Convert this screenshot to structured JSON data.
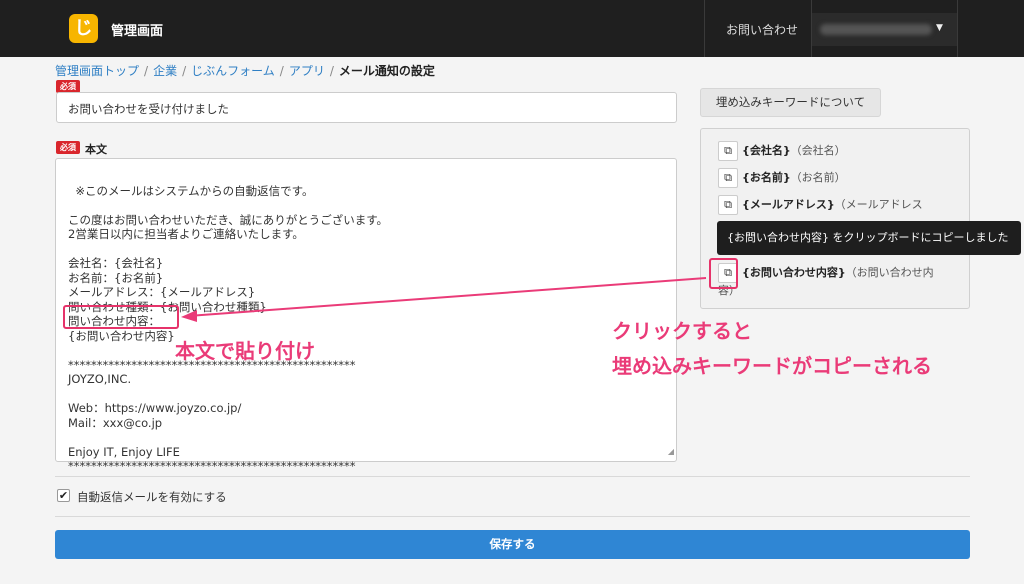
{
  "header": {
    "logo_glyph": "じ",
    "app_title": "管理画面",
    "nav_contact": "お問い合わせ",
    "user_caret": "▼"
  },
  "breadcrumb": {
    "items": [
      "管理画面トップ",
      "企業",
      "じぶんフォーム",
      "アプリ"
    ],
    "separator": "/",
    "current": "メール通知の設定"
  },
  "form": {
    "required_badge": "必須",
    "subject_value": "お問い合わせを受け付けました",
    "body_label": "本文",
    "body_text": "※このメールはシステムからの自動返信です。\n\nこの度はお問い合わせいただき、誠にありがとうございます。\n2営業日以内に担当者よりご連絡いたします。\n\n会社名：{会社名}\nお名前：{お名前}\nメールアドレス：{メールアドレス}\n問い合わせ種類：{お問い合わせ種類}\n問い合わせ内容：\n{お問い合わせ内容}\n\n**************************************************\nJOYZO,INC.\n\nWeb：https://www.joyzo.co.jp/\nMail：xxx@co.jp\n\nEnjoy IT, Enjoy LIFE\n**************************************************",
    "autoreply_label": "自動返信メールを有効にする",
    "autoreply_checked": true,
    "save_label": "保存する"
  },
  "keywords": {
    "button_label": "埋め込みキーワードについて",
    "items": [
      {
        "key": "{会社名}",
        "desc": "（会社名）"
      },
      {
        "key": "{お名前}",
        "desc": "（お名前）"
      },
      {
        "key": "{メールアドレス}",
        "desc": "（メールアドレス"
      },
      {
        "key": "{お問い合わせ内容}",
        "desc": "（お問い合わせ内容）"
      }
    ],
    "tooltip": "{お問い合わせ内容} をクリップボードにコピーしました"
  },
  "annotations": {
    "paste": "本文で貼り付け",
    "copy_line1": "クリックすると",
    "copy_line2": "埋め込みキーワードがコピーされる"
  },
  "colors": {
    "topbar": "#1f1f1f",
    "logo": "#f7b500",
    "primary": "#2f86d4",
    "required": "#d9262c",
    "annotation": "#ea3b78"
  }
}
